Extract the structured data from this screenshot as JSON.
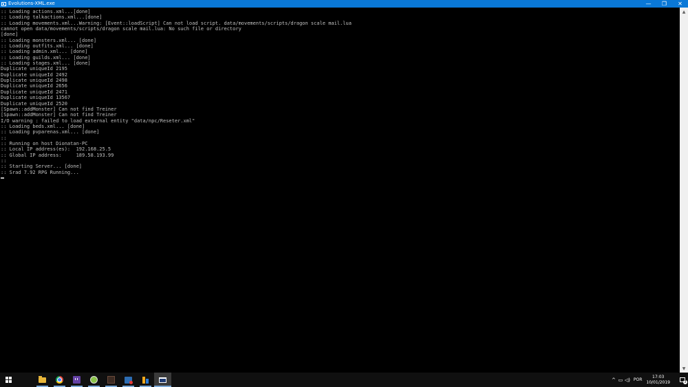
{
  "window": {
    "title": "Evolutions-XML.exe",
    "minimize_label": "—",
    "maximize_label": "❐",
    "close_label": "✕"
  },
  "console": {
    "lines": [
      ":: Loading actions.xml...[done]",
      ":: Loading talkactions.xml...[done]",
      ":: Loading movements.xml...Warning: [Event::loadScript] Can not load script. data/movements/scripts/dragon scale mail.lua",
      "cannot open data/movements/scripts/dragon scale mail.lua: No such file or directory",
      "[done]",
      ":: Loading monsters.xml... [done]",
      ":: Loading outfits.xml... [done]",
      ":: Loading admin.xml... [done]",
      ":: Loading guilds.xml... [done]",
      ":: Loading stages.xml... [done]",
      "Duplicate uniqueId 2195",
      "Duplicate uniqueId 2492",
      "Duplicate uniqueId 2498",
      "Duplicate uniqueId 2656",
      "Duplicate uniqueId 2471",
      "Duplicate uniqueId 13567",
      "Duplicate uniqueId 2520",
      "[Spawn::addMonster] Can not find Treiner",
      "[Spawn::addMonster] Can not find Treiner",
      "I/O warning : failed to load external entity \"data/npc/Reseter.xml\"",
      ":: Loading beds.xml... [done]",
      ":: Loading pvparenas.xml... [done]",
      "::",
      ":: Running on host Dionatan-PC",
      ":: Local IP address(es):  192.168.25.5",
      ":: Global IP address:     189.58.193.99",
      "::",
      ":: Starting Server... [done]",
      ":: Srad 7.92 RPG Running..."
    ]
  },
  "taskbar": {
    "apps": [
      {
        "name": "start-button",
        "icon": "windows-logo-icon"
      },
      {
        "name": "file-explorer",
        "icon": "folder-icon"
      },
      {
        "name": "chrome",
        "icon": "chrome-icon"
      },
      {
        "name": "twitch",
        "icon": "twitch-icon"
      },
      {
        "name": "app-ball",
        "icon": "ball-icon"
      },
      {
        "name": "app-dark",
        "icon": "dark-app-icon"
      },
      {
        "name": "app-tool",
        "icon": "tool-icon"
      },
      {
        "name": "app-book",
        "icon": "book-icon"
      },
      {
        "name": "console-window",
        "icon": "console-icon"
      }
    ],
    "tray": {
      "chevron": "^",
      "network": "▭",
      "volume": "◁)",
      "language": "POR",
      "time": "17:03",
      "date": "10/01/2019",
      "notification_count": "3"
    }
  },
  "colors": {
    "titlebar": "#0a78d7",
    "console_bg": "#000000",
    "console_text": "#c0c0c0",
    "taskbar": "#101010"
  }
}
